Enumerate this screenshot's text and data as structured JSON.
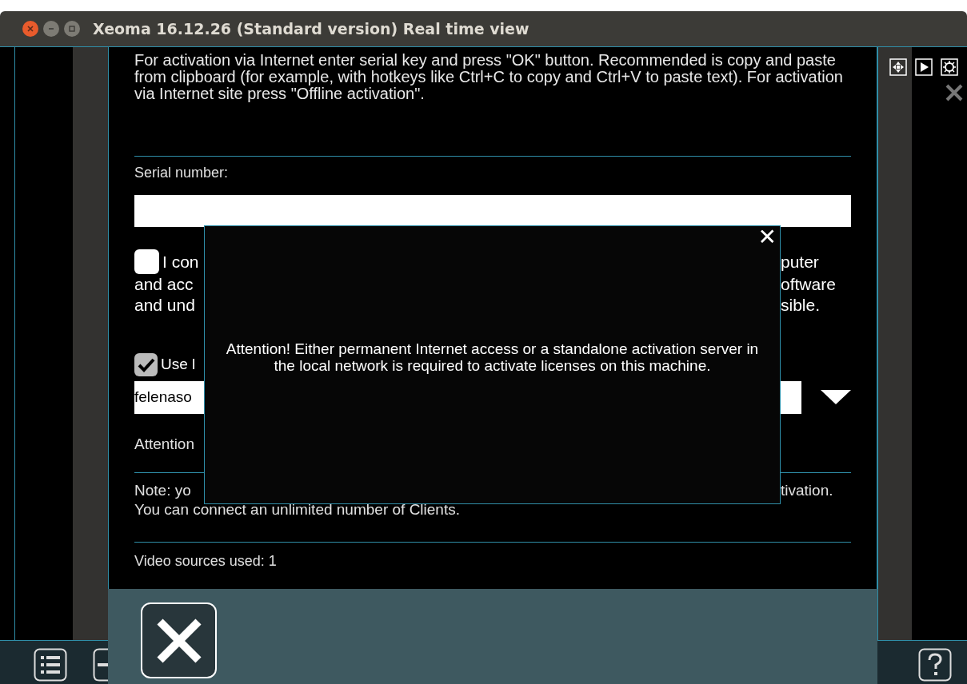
{
  "window": {
    "title": "Xeoma 16.12.26 (Standard version) Real time view"
  },
  "activation_dialog": {
    "instructions": "For activation via Internet enter serial key and press \"OK\" button. Recommended is copy and paste from clipboard (for example, with hotkeys like Ctrl+C to copy and Ctrl+V to paste text). For activation via Internet site press \"Offline activation\".",
    "serial_label": "Serial number:",
    "options": [
      {
        "checked": false,
        "kind": "large",
        "lines": [
          {
            "left": "I con",
            "right": "puter"
          },
          {
            "left": "and acc",
            "right": "oftware"
          },
          {
            "left": "and und",
            "right": "sible."
          }
        ]
      },
      {
        "checked": true,
        "kind": "small",
        "lines": [
          {
            "left": "Use l"
          }
        ]
      }
    ],
    "server_value": "felenaso",
    "attention": "Attention",
    "note_lines": [
      {
        "left": "Note: yo",
        "right": "tivation."
      },
      {
        "left": "You can connect an unlimited number of Clients."
      }
    ],
    "video_sources": "Video sources used: 1"
  },
  "popup": {
    "message": "Attention! Either permanent Internet access or a standalone activation server in the local network is required to activate licenses on this machine.",
    "close": "✕"
  }
}
